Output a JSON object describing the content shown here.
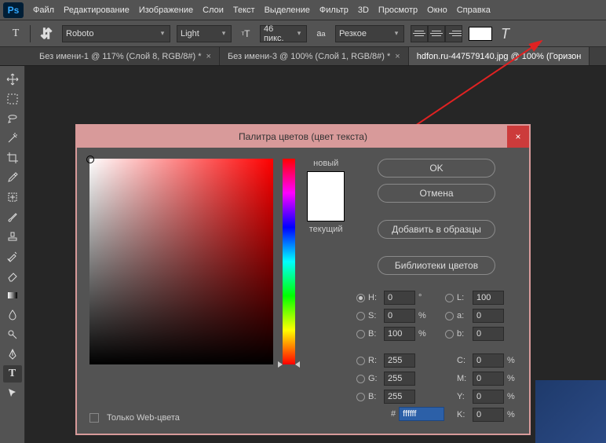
{
  "menu": {
    "items": [
      "Файл",
      "Редактирование",
      "Изображение",
      "Слои",
      "Текст",
      "Выделение",
      "Фильтр",
      "3D",
      "Просмотр",
      "Окно",
      "Справка"
    ]
  },
  "optbar": {
    "font": "Roboto",
    "weight": "Light",
    "size": "46 пикс.",
    "aa": "Резкое",
    "color": "#ffffff"
  },
  "tabs": [
    {
      "label": "Без имени-1 @ 117% (Слой 8, RGB/8#) *"
    },
    {
      "label": "Без имени-3 @ 100% (Слой 1, RGB/8#) *"
    },
    {
      "label": "hdfon.ru-447579140.jpg @ 100% (Горизон"
    }
  ],
  "dialog": {
    "title": "Палитра цветов (цвет текста)",
    "ok": "OK",
    "cancel": "Отмена",
    "add": "Добавить в образцы",
    "libs": "Библиотеки цветов",
    "new_label": "новый",
    "current_label": "текущий",
    "web_only": "Только Web-цвета",
    "hash": "#",
    "hex": "ffffff",
    "hsb": {
      "H": "0",
      "S": "0",
      "B": "100"
    },
    "lab": {
      "L": "100",
      "a": "0",
      "b": "0"
    },
    "rgb": {
      "R": "255",
      "G": "255",
      "B": "255"
    },
    "cmyk": {
      "C": "0",
      "M": "0",
      "Y": "0",
      "K": "0"
    },
    "deg": "°",
    "pct": "%"
  }
}
